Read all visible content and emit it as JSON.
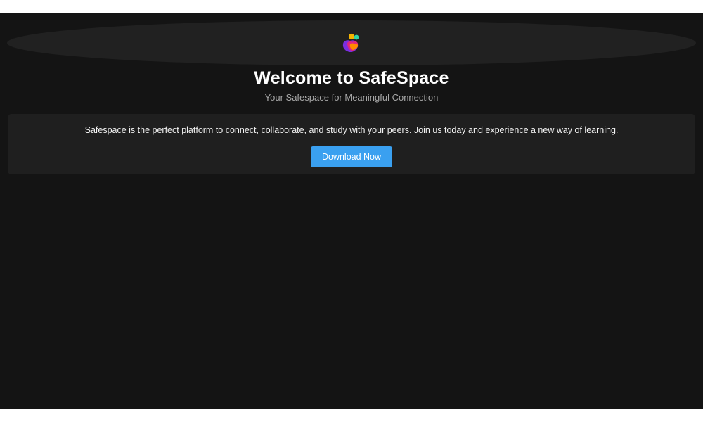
{
  "header": {
    "logo_icon": "safespace-people-logo-icon",
    "title": "Welcome to SafeSpace",
    "subtitle": "Your Safespace for Meaningful Connection"
  },
  "intro": {
    "text": "Safespace is the perfect platform to connect, collaborate, and study with your peers. Join us today and experience a new way of learning.",
    "download_label": "Download Now"
  },
  "colors": {
    "background": "#141414",
    "panel": "#1f1f1f",
    "accent": "#3aa0f0",
    "title": "#ffffff",
    "subtitle": "#a8a8a8"
  }
}
